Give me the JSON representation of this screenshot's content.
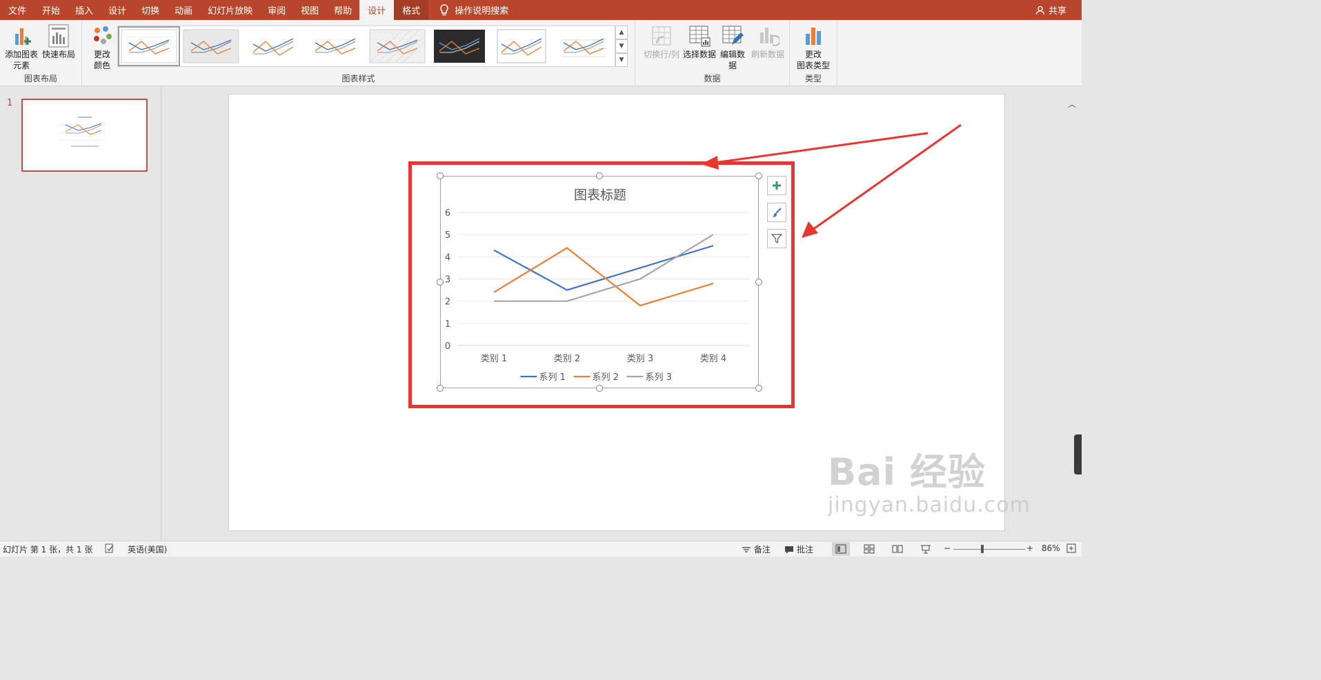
{
  "tabs": [
    {
      "label": "文件",
      "state": "normal"
    },
    {
      "label": "开始",
      "state": "normal"
    },
    {
      "label": "插入",
      "state": "normal"
    },
    {
      "label": "设计",
      "state": "normal"
    },
    {
      "label": "切换",
      "state": "normal"
    },
    {
      "label": "动画",
      "state": "normal"
    },
    {
      "label": "幻灯片放映",
      "state": "normal"
    },
    {
      "label": "审阅",
      "state": "normal"
    },
    {
      "label": "视图",
      "state": "normal"
    },
    {
      "label": "帮助",
      "state": "normal"
    },
    {
      "label": "设计",
      "state": "active"
    },
    {
      "label": "格式",
      "state": "format"
    }
  ],
  "tell_me": "操作说明搜索",
  "share": "共享",
  "ribbon": {
    "add_element": {
      "line1": "添加图表",
      "line2": "元素"
    },
    "quick_layout": "快速布局",
    "chart_layout_group": "图表布局",
    "change_colors": {
      "line1": "更改",
      "line2": "颜色"
    },
    "chart_styles_group": "图表样式",
    "switch_row_col": "切换行/列",
    "select_data": "选择数据",
    "edit_data": {
      "line1": "编辑数",
      "line2": "据"
    },
    "refresh_data": "刷新数据",
    "data_group": "数据",
    "change_type": {
      "line1": "更改",
      "line2": "图表类型"
    },
    "type_group": "类型"
  },
  "thumbnail": {
    "number": "1"
  },
  "chart_data": {
    "type": "line",
    "title": "图表标题",
    "categories": [
      "类别 1",
      "类别 2",
      "类别 3",
      "类别 4"
    ],
    "ylim": [
      0,
      6
    ],
    "yticks": [
      "0",
      "1",
      "2",
      "3",
      "4",
      "5",
      "6"
    ],
    "grid": true,
    "legend": "bottom",
    "series": [
      {
        "name": "系列 1",
        "values": [
          4.3,
          2.5,
          3.5,
          4.5
        ],
        "color": "#4472c4"
      },
      {
        "name": "系列 2",
        "values": [
          2.4,
          4.4,
          1.8,
          2.8
        ],
        "color": "#ed7d31"
      },
      {
        "name": "系列 3",
        "values": [
          2,
          2,
          3,
          5
        ],
        "color": "#a5a5a5"
      }
    ]
  },
  "statusbar": {
    "slide_info": "幻灯片 第 1 张，共 1 张",
    "language": "英语(美国)",
    "notes": "备注",
    "comments": "批注",
    "zoom": "86%"
  },
  "watermark": {
    "brand": "Bai 经验",
    "site": "jingyan.baidu.com"
  }
}
